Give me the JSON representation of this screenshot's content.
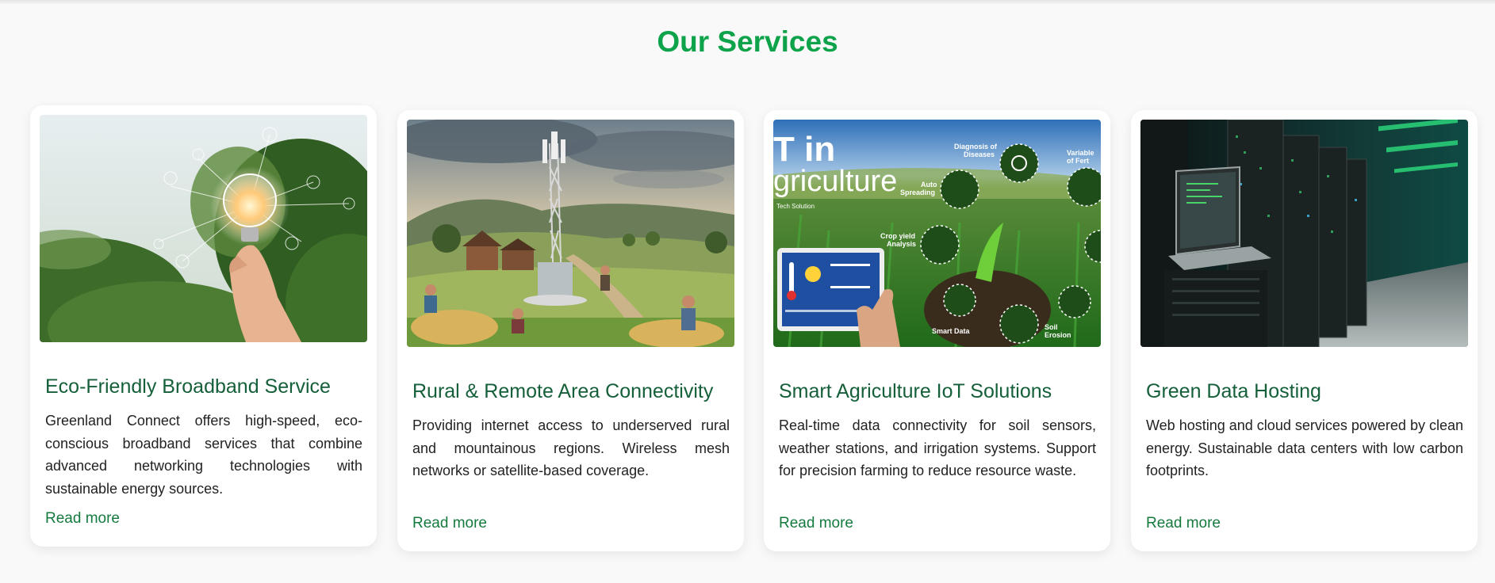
{
  "section": {
    "title": "Our Services"
  },
  "cards": [
    {
      "title": "Eco-Friendly Broadband Service",
      "description": "Greenland Connect offers high-speed, eco-conscious broadband services that combine advanced networking technologies with sustainable energy sources.",
      "link": "Read more"
    },
    {
      "title": "Rural & Remote Area Connectivity",
      "description": "Providing internet access to underserved rural and mountainous regions. Wireless mesh networks or satellite-based coverage.",
      "link": "Read more"
    },
    {
      "title": "Smart Agriculture IoT Solutions",
      "description": "Real-time data connectivity for soil sensors, weather stations, and irrigation systems. Support for precision farming to reduce resource waste.",
      "link": "Read more"
    },
    {
      "title": "Green Data Hosting",
      "description": "Web hosting and cloud services powered by clean energy. Sustainable data centers with low carbon footprints.",
      "link": "Read more"
    }
  ],
  "image_text": {
    "iot_title_1": "T in",
    "iot_title_2": "griculture",
    "iot_sub": "Tech Solution",
    "diag_1": "Diagnosis of",
    "diag_2": "Diseases",
    "var_1": "Variable",
    "var_2": "of Fert",
    "auto_1": "Auto",
    "auto_2": "Spreading",
    "crop_1": "Crop yield",
    "crop_2": "Analysis",
    "smart": "Smart Data",
    "soil_1": "Soil",
    "soil_2": "Erosion"
  },
  "colors": {
    "accent": "#0ea34a",
    "title": "#15603a",
    "link": "#157a3e"
  }
}
